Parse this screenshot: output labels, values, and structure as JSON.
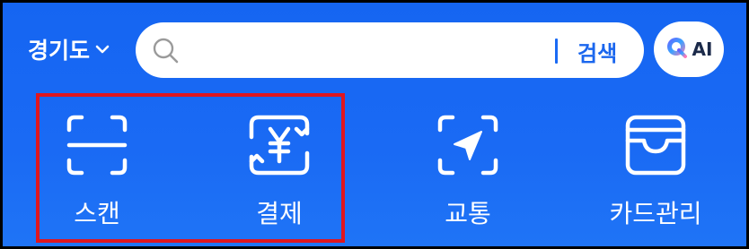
{
  "header": {
    "region_label": "경기도",
    "search": {
      "placeholder": "",
      "value": "",
      "button_label": "검색"
    },
    "ai_button_label": "AI"
  },
  "shortcuts": [
    {
      "label": "스캔",
      "icon": "scan-icon"
    },
    {
      "label": "결제",
      "icon": "payment-yen-icon"
    },
    {
      "label": "교통",
      "icon": "transport-arrow-icon"
    },
    {
      "label": "카드관리",
      "icon": "card-wallet-icon"
    }
  ],
  "colors": {
    "background": "#1a6af4",
    "highlight_border": "#e0161e",
    "search_accent": "#1a66ee"
  }
}
